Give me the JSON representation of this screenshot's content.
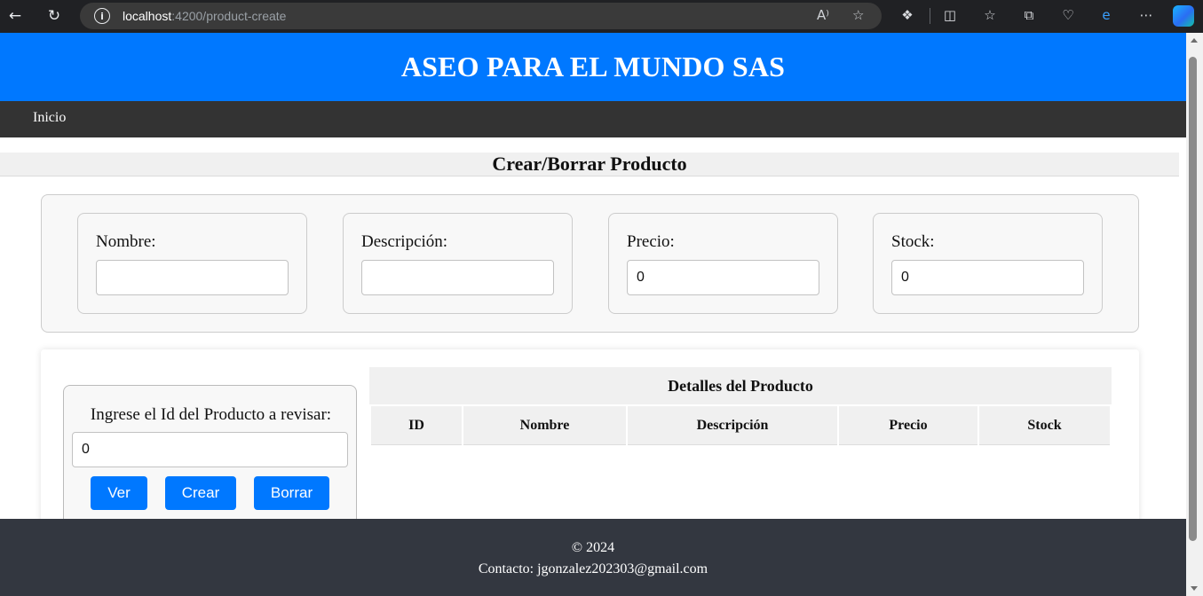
{
  "browser": {
    "url_host": "localhost",
    "url_path": ":4200/product-create"
  },
  "header": {
    "title": "ASEO PARA EL MUNDO SAS"
  },
  "nav": {
    "home_label": "Inicio"
  },
  "page": {
    "title": "Crear/Borrar Producto"
  },
  "form": {
    "fields": [
      {
        "label": "Nombre:",
        "value": ""
      },
      {
        "label": "Descripción:",
        "value": ""
      },
      {
        "label": "Precio:",
        "value": "0"
      },
      {
        "label": "Stock:",
        "value": "0"
      }
    ]
  },
  "lookup": {
    "label": "Ingrese el Id del Producto a revisar:",
    "value": "0",
    "buttons": {
      "view": "Ver",
      "create": "Crear",
      "delete": "Borrar"
    }
  },
  "details": {
    "caption": "Detalles del Producto",
    "columns": [
      "ID",
      "Nombre",
      "Descripción",
      "Precio",
      "Stock"
    ]
  },
  "footer": {
    "copyright": "© 2024",
    "contact": "Contacto: jgonzalez202303@gmail.com"
  },
  "colors": {
    "primary": "#0078ff",
    "navbar": "#333333",
    "footer": "#333740"
  }
}
